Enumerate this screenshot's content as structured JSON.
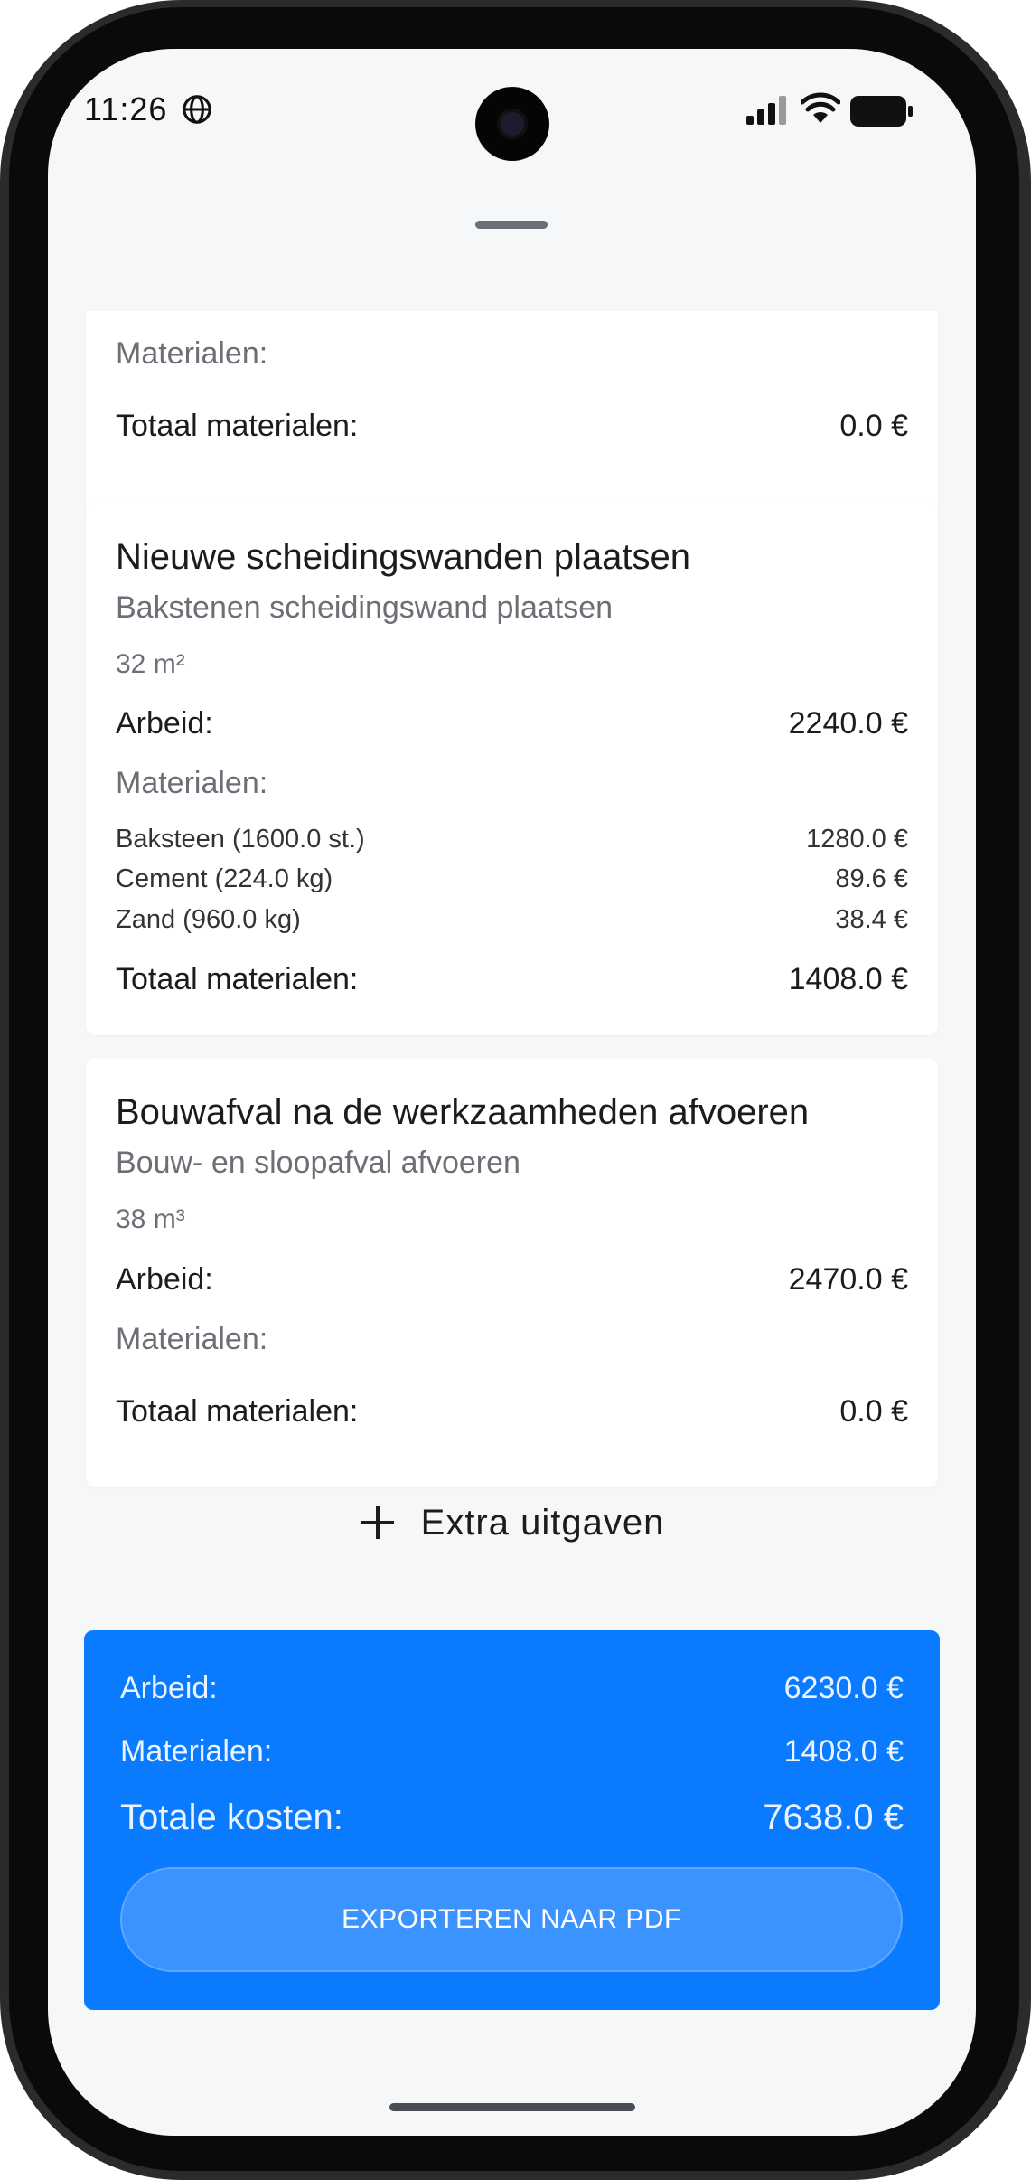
{
  "status_bar": {
    "time": "11:26"
  },
  "cards": [
    {
      "materials_label": "Materialen:",
      "total_materials_label": "Totaal materialen:",
      "total_materials_value": "0.0 €"
    },
    {
      "title": "Nieuwe scheidingswanden plaatsen",
      "subtitle": "Bakstenen scheidingswand plaatsen",
      "quantity": "32 m²",
      "labor_label": "Arbeid:",
      "labor_value": "2240.0 €",
      "materials_label": "Materialen:",
      "items": [
        {
          "name": "Baksteen (1600.0 st.)",
          "price": "1280.0 €"
        },
        {
          "name": "Cement (224.0 kg)",
          "price": "89.6 €"
        },
        {
          "name": "Zand (960.0 kg)",
          "price": "38.4 €"
        }
      ],
      "total_materials_label": "Totaal materialen:",
      "total_materials_value": "1408.0 €"
    },
    {
      "title": "Bouwafval na de werkzaamheden afvoeren",
      "subtitle": "Bouw- en sloopafval afvoeren",
      "quantity": "38 m³",
      "labor_label": "Arbeid:",
      "labor_value": "2470.0 €",
      "materials_label": "Materialen:",
      "total_materials_label": "Totaal materialen:",
      "total_materials_value": "0.0 €"
    }
  ],
  "extra_button": {
    "label": "Extra uitgaven"
  },
  "summary": {
    "labor_label": "Arbeid:",
    "labor_value": "6230.0 €",
    "materials_label": "Materialen:",
    "materials_value": "1408.0 €",
    "total_label": "Totale kosten:",
    "total_value": "7638.0 €",
    "export_label": "EXPORTEREN NAAR PDF"
  },
  "colors": {
    "accent": "#0a7bff",
    "background": "#f6f7f9",
    "card": "#ffffff"
  }
}
